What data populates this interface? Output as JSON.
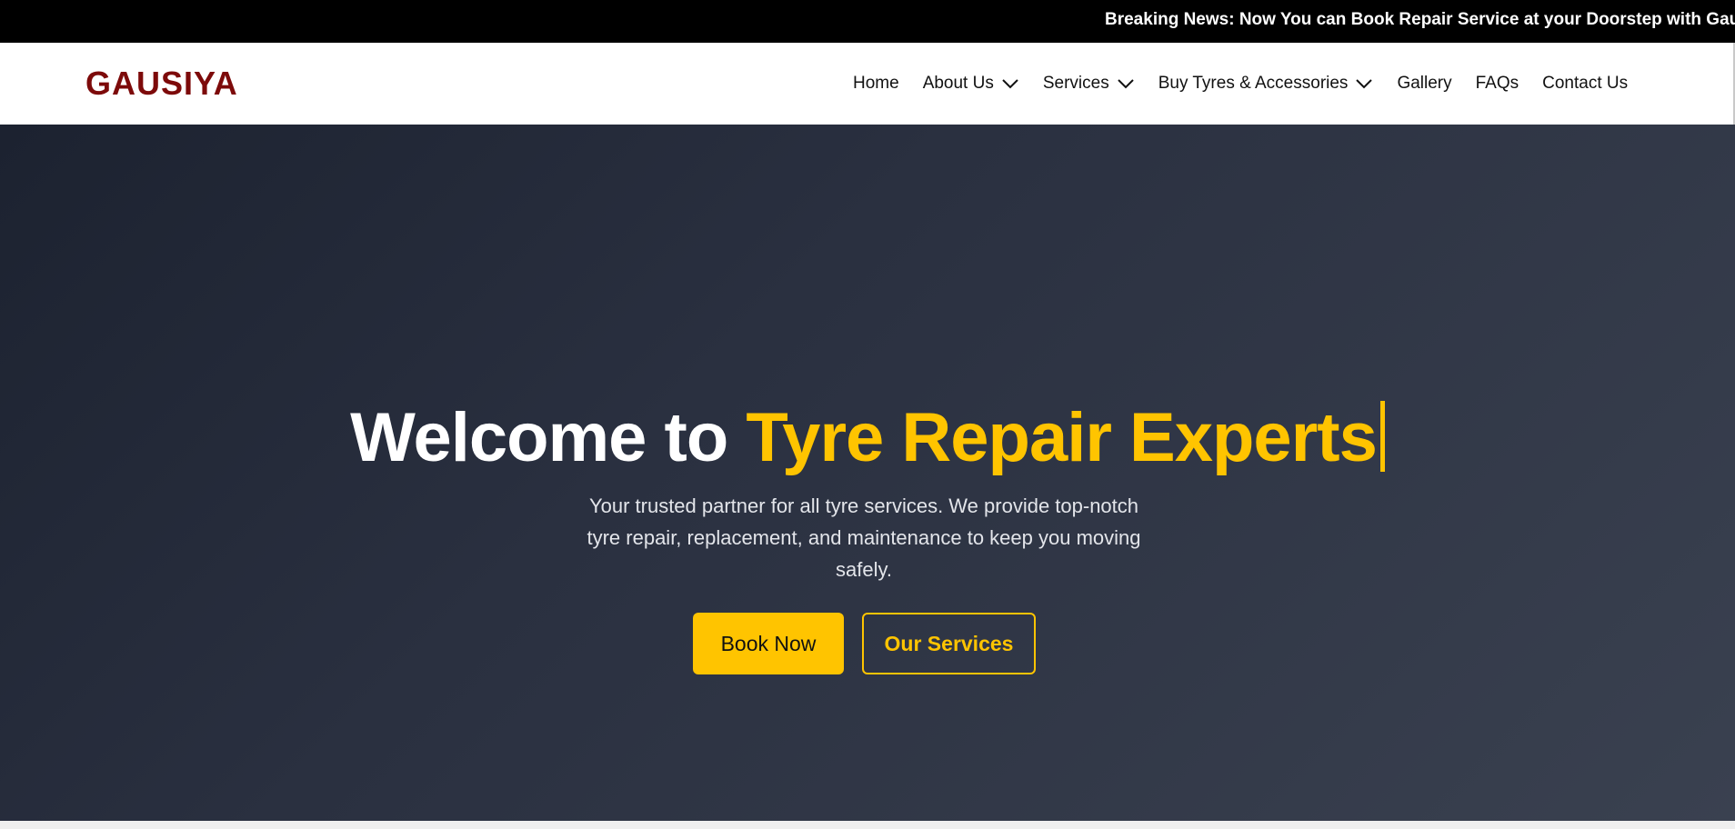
{
  "ticker": {
    "text": "Breaking News: Now You can Book Repair Service at your Doorstep with Gausiy"
  },
  "brand": {
    "logo": "GAUSIYA"
  },
  "nav": {
    "home": "Home",
    "about": "About Us",
    "services": "Services",
    "buy": "Buy Tyres & Accessories",
    "gallery": "Gallery",
    "faqs": "FAQs",
    "contact": "Contact Us"
  },
  "hero": {
    "title_white": "Welcome to ",
    "title_yellow": "Tyre Repair Experts",
    "subtitle": "Your trusted partner for all tyre services. We provide top-notch tyre repair, replacement, and maintenance to keep you moving safely.",
    "book_label": "Book Now",
    "services_label": "Our Services"
  },
  "colors": {
    "accent": "#ffc400",
    "logo": "#7d0a0a",
    "ticker_bg": "#000000",
    "hero_bg": "#2a3040"
  },
  "icons": {
    "dropdown": "chevron-down-icon"
  }
}
